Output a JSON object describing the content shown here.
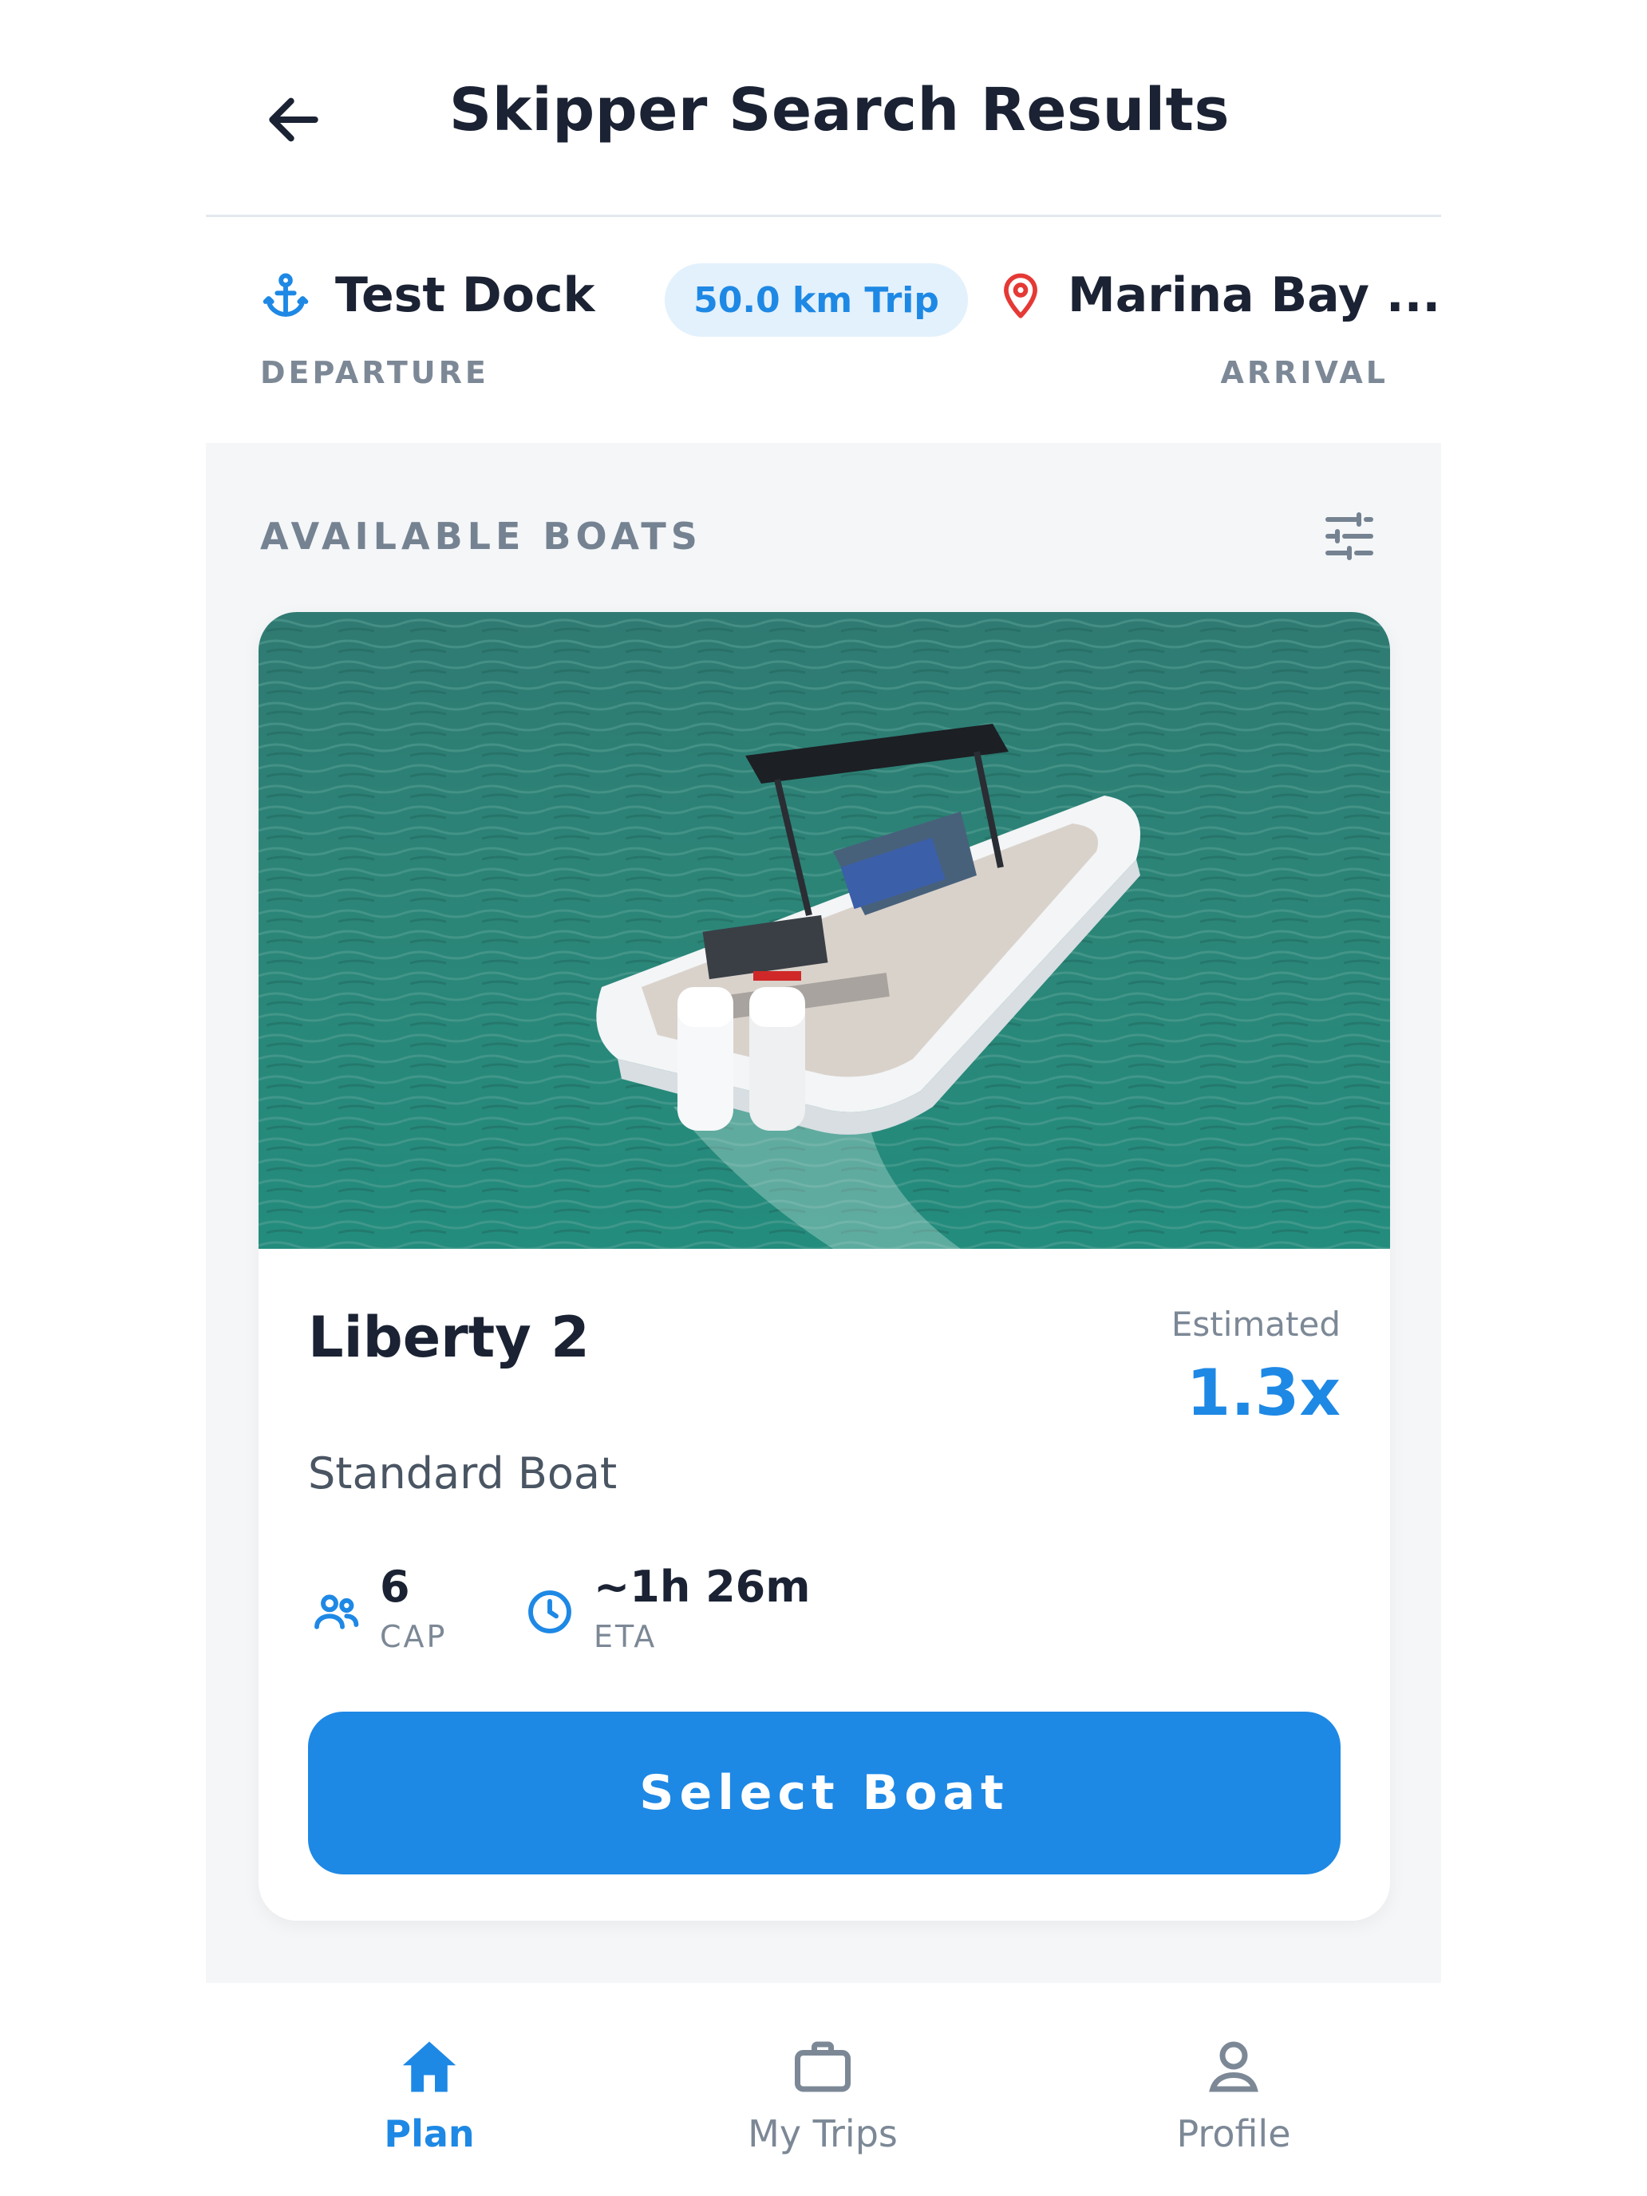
{
  "header": {
    "title": "Skipper Search Results",
    "back_icon": "arrow-left-icon"
  },
  "route": {
    "departure_name": "Test Dock",
    "departure_label": "DEPARTURE",
    "trip_distance": "50.0 km Trip",
    "arrival_name": "Marina Bay ...",
    "arrival_label": "ARRIVAL"
  },
  "section": {
    "title": "AVAILABLE BOATS",
    "filter_icon": "sliders-icon"
  },
  "boat": {
    "name": "Liberty 2",
    "type": "Standard Boat",
    "estimated_label": "Estimated",
    "estimated_value": "1.3x",
    "capacity_value": "6",
    "capacity_label": "CAP",
    "eta_value": "~1h 26m",
    "eta_label": "ETA",
    "select_label": "Select Boat"
  },
  "nav": {
    "plan": "Plan",
    "trips": "My Trips",
    "profile": "Profile"
  },
  "colors": {
    "accent": "#1e88e5",
    "pin": "#e53935",
    "muted": "#7c8896",
    "text": "#1a2233"
  }
}
